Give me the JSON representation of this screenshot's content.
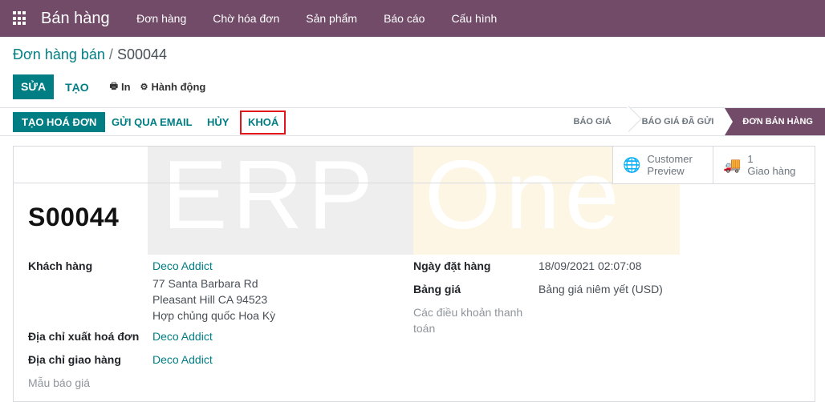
{
  "topbar": {
    "app_title": "Bán hàng",
    "menu": [
      "Đơn hàng",
      "Chờ hóa đơn",
      "Sản phẩm",
      "Báo cáo",
      "Cấu hình"
    ]
  },
  "breadcrumb": {
    "parent": "Đơn hàng bán",
    "separator": "/",
    "current": "S00044"
  },
  "control": {
    "edit_label": "SỬA",
    "create_label": "TẠO",
    "print_label": "In",
    "action_label": "Hành động",
    "print_icon": "printer-icon",
    "action_icon": "gear-icon"
  },
  "statusbar": {
    "create_invoice": "TẠO HOÁ ĐƠN",
    "send_email": "GỬI QUA EMAIL",
    "cancel": "HỦY",
    "lock": "KHOÁ",
    "stages": [
      {
        "label": "BÁO GIÁ",
        "active": false
      },
      {
        "label": "BÁO GIÁ ĐÃ GỬI",
        "active": false
      },
      {
        "label": "ĐƠN BÁN HÀNG",
        "active": true
      }
    ]
  },
  "watermark": {
    "left": "ERP",
    "right": "One"
  },
  "buttonbox": {
    "preview_line1": "Customer",
    "preview_line2": "Preview",
    "preview_icon": "globe-icon",
    "delivery_count": "1",
    "delivery_label": "Giao hàng",
    "delivery_icon": "truck-icon"
  },
  "form": {
    "name": "S00044",
    "customer_label": "Khách hàng",
    "customer_name": "Deco Addict",
    "customer_address": [
      "77 Santa Barbara Rd",
      "Pleasant Hill CA 94523",
      "Hợp chủng quốc Hoa Kỳ"
    ],
    "invoice_address_label": "Địa chỉ xuất hoá đơn",
    "invoice_address": "Deco Addict",
    "delivery_address_label": "Địa chỉ giao hàng",
    "delivery_address": "Deco Addict",
    "template_label": "Mẫu báo giá",
    "order_date_label": "Ngày đặt hàng",
    "order_date": "18/09/2021 02:07:08",
    "pricelist_label": "Bảng giá",
    "pricelist": "Bảng giá niêm yết (USD)",
    "payment_terms_label_line1": "Các điều khoản thanh",
    "payment_terms_label_line2": "toán"
  },
  "colors": {
    "brand": "#714b67",
    "accent": "#017e84",
    "highlight": "#e0161c"
  }
}
